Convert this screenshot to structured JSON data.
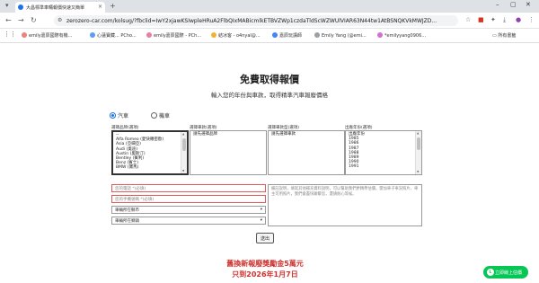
{
  "browser": {
    "tab_title": "大昌標準車輛報價快速又簡單",
    "url": "zerozero-car.com/kolsug/?fbclid=IwY2xjawKSIwpleHRuA2FlbQIxMABicmlkETBVZWp1czdaTldScWZWUlVIAR63N44tw1AtBSNQKVkMWJZD...",
    "bookmarks": [
      {
        "label": "emily嘉辰國際有機...",
        "color": "#e8837e"
      },
      {
        "label": "心蓮寶藏... PCho...",
        "color": "#5e9cec"
      },
      {
        "label": "emily嘉辰國際 - PCh...",
        "color": "#e87ea3"
      },
      {
        "label": "結冰客 - o4nyal@...",
        "color": "#f2b135"
      },
      {
        "label": "嘉辰玩講師",
        "color": "#4285f4"
      },
      {
        "label": "Emily Yang (@emi...",
        "color": "#9aa0a6"
      },
      {
        "label": "*emilyyang0906...",
        "color": "#d06fd0"
      }
    ],
    "all_bookmarks": "所有書籤"
  },
  "form": {
    "title": "免費取得報價",
    "subtitle": "輸入您的年份與車款，取得精準汽車報廢價格",
    "radio_car": "汽車",
    "radio_moto": "機車",
    "col_brand": "選擇品牌(選項)",
    "col_model": "選擇車款(選項)",
    "col_submodel": "選擇車款型(選項)",
    "col_year": "出廠年份(選項)",
    "brands": [
      "--",
      "Alfa Romeo (愛快羅密歐)",
      "Asia (亞細亞)",
      "Audi (奧迪)",
      "Austin (奧斯汀)",
      "Bentley (賓利)",
      "Benz (賓士)",
      "BMW (寶馬)"
    ],
    "models": [
      "請先選擇品牌"
    ],
    "submodels": [
      "請先選擇車款"
    ],
    "years": [
      "出廠年份",
      "1985",
      "1986",
      "1987",
      "1988",
      "1989",
      "1990",
      "1991"
    ],
    "phone_placeholder": "您的電話 *(必填)",
    "line_placeholder": "您的手機號碼 *(必填)",
    "city_select": "車輛所在縣市",
    "district_select": "車輛所在鄉鎮",
    "notes_placeholder": "備註說明，填寫其他補充資料說明，可以幫助我們更精準估價，需加車子車況照片、車主可用照片，我們會盡快聯繫您，還請耐心等候。",
    "submit": "送出"
  },
  "promo": {
    "line1": "舊換新報廢獎勵金5萬元",
    "line2": "只到2026年1月7日"
  },
  "line_button": {
    "label": "立即線上估價"
  }
}
